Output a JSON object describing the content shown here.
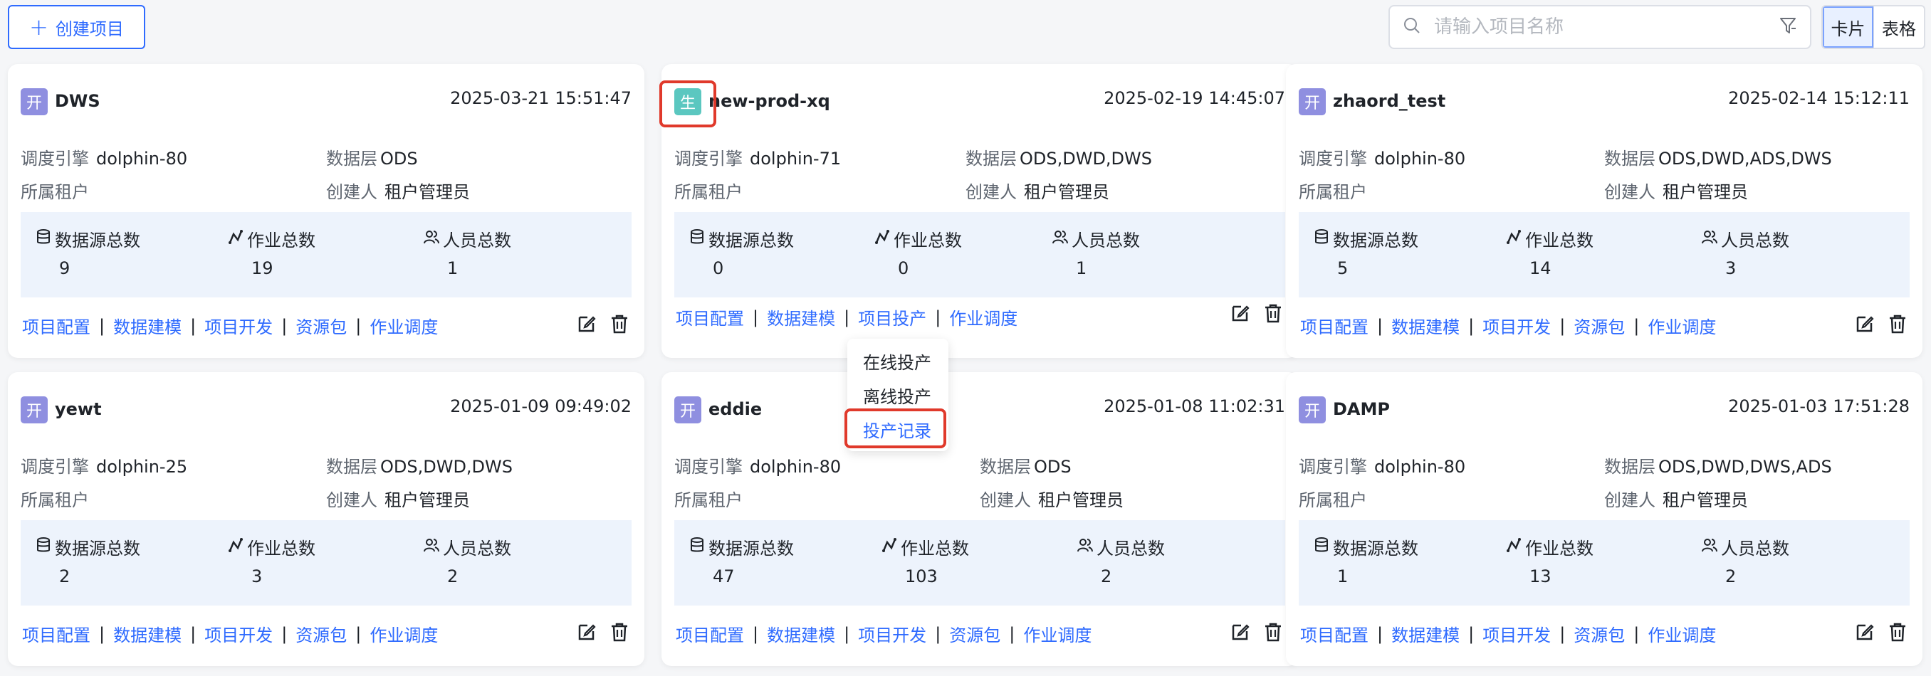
{
  "toolbar": {
    "create_label": "创建项目",
    "search_placeholder": "请输入项目名称",
    "view_card": "卡片",
    "view_table": "表格"
  },
  "labels": {
    "engine": "调度引擎",
    "layer": "数据层",
    "tenant": "所属租户",
    "creator": "创建人",
    "ds_count": "数据源总数",
    "job_count": "作业总数",
    "member_count": "人员总数"
  },
  "links": {
    "config": "项目配置",
    "model": "数据建模",
    "dev": "项目开发",
    "prod": "项目投产",
    "resource": "资源包",
    "schedule": "作业调度",
    "sep": "|"
  },
  "projects": [
    {
      "badge": "开",
      "name": "DWS",
      "time": "2025-03-21 15:51:47",
      "engine": "dolphin-80",
      "layer": "ODS",
      "tenant": "",
      "creator": "租户管理员",
      "ds": "9",
      "jobs": "19",
      "members": "1"
    },
    {
      "badge": "生",
      "name": "new-prod-xq",
      "time": "2025-02-19 14:45:07",
      "engine": "dolphin-71",
      "layer": "ODS,DWD,DWS",
      "tenant": "",
      "creator": "租户管理员",
      "ds": "0",
      "jobs": "0",
      "members": "1"
    },
    {
      "badge": "开",
      "name": "zhaord_test",
      "time": "2025-02-14 15:12:11",
      "engine": "dolphin-80",
      "layer": "ODS,DWD,ADS,DWS",
      "tenant": "",
      "creator": "租户管理员",
      "ds": "5",
      "jobs": "14",
      "members": "3"
    },
    {
      "badge": "开",
      "name": "yewt",
      "time": "2025-01-09 09:49:02",
      "engine": "dolphin-25",
      "layer": "ODS,DWD,DWS",
      "tenant": "",
      "creator": "租户管理员",
      "ds": "2",
      "jobs": "3",
      "members": "2"
    },
    {
      "badge": "开",
      "name": "eddie",
      "time": "2025-01-08 11:02:31",
      "engine": "dolphin-80",
      "layer": "ODS",
      "tenant": "",
      "creator": "租户管理员",
      "ds": "47",
      "jobs": "103",
      "members": "2"
    },
    {
      "badge": "开",
      "name": "DAMP",
      "time": "2025-01-03 17:51:28",
      "engine": "dolphin-80",
      "layer": "ODS,DWD,DWS,ADS",
      "tenant": "",
      "creator": "租户管理员",
      "ds": "1",
      "jobs": "13",
      "members": "2"
    }
  ],
  "dropdown": {
    "items": [
      "在线投产",
      "离线投产",
      "投产记录"
    ]
  },
  "colors": {
    "accent": "#2f6bff",
    "highlight": "#e0392b",
    "dev_badge": "#8f8fe0",
    "prod_badge": "#5bc7c0",
    "stats_bg": "#edf3fc"
  }
}
